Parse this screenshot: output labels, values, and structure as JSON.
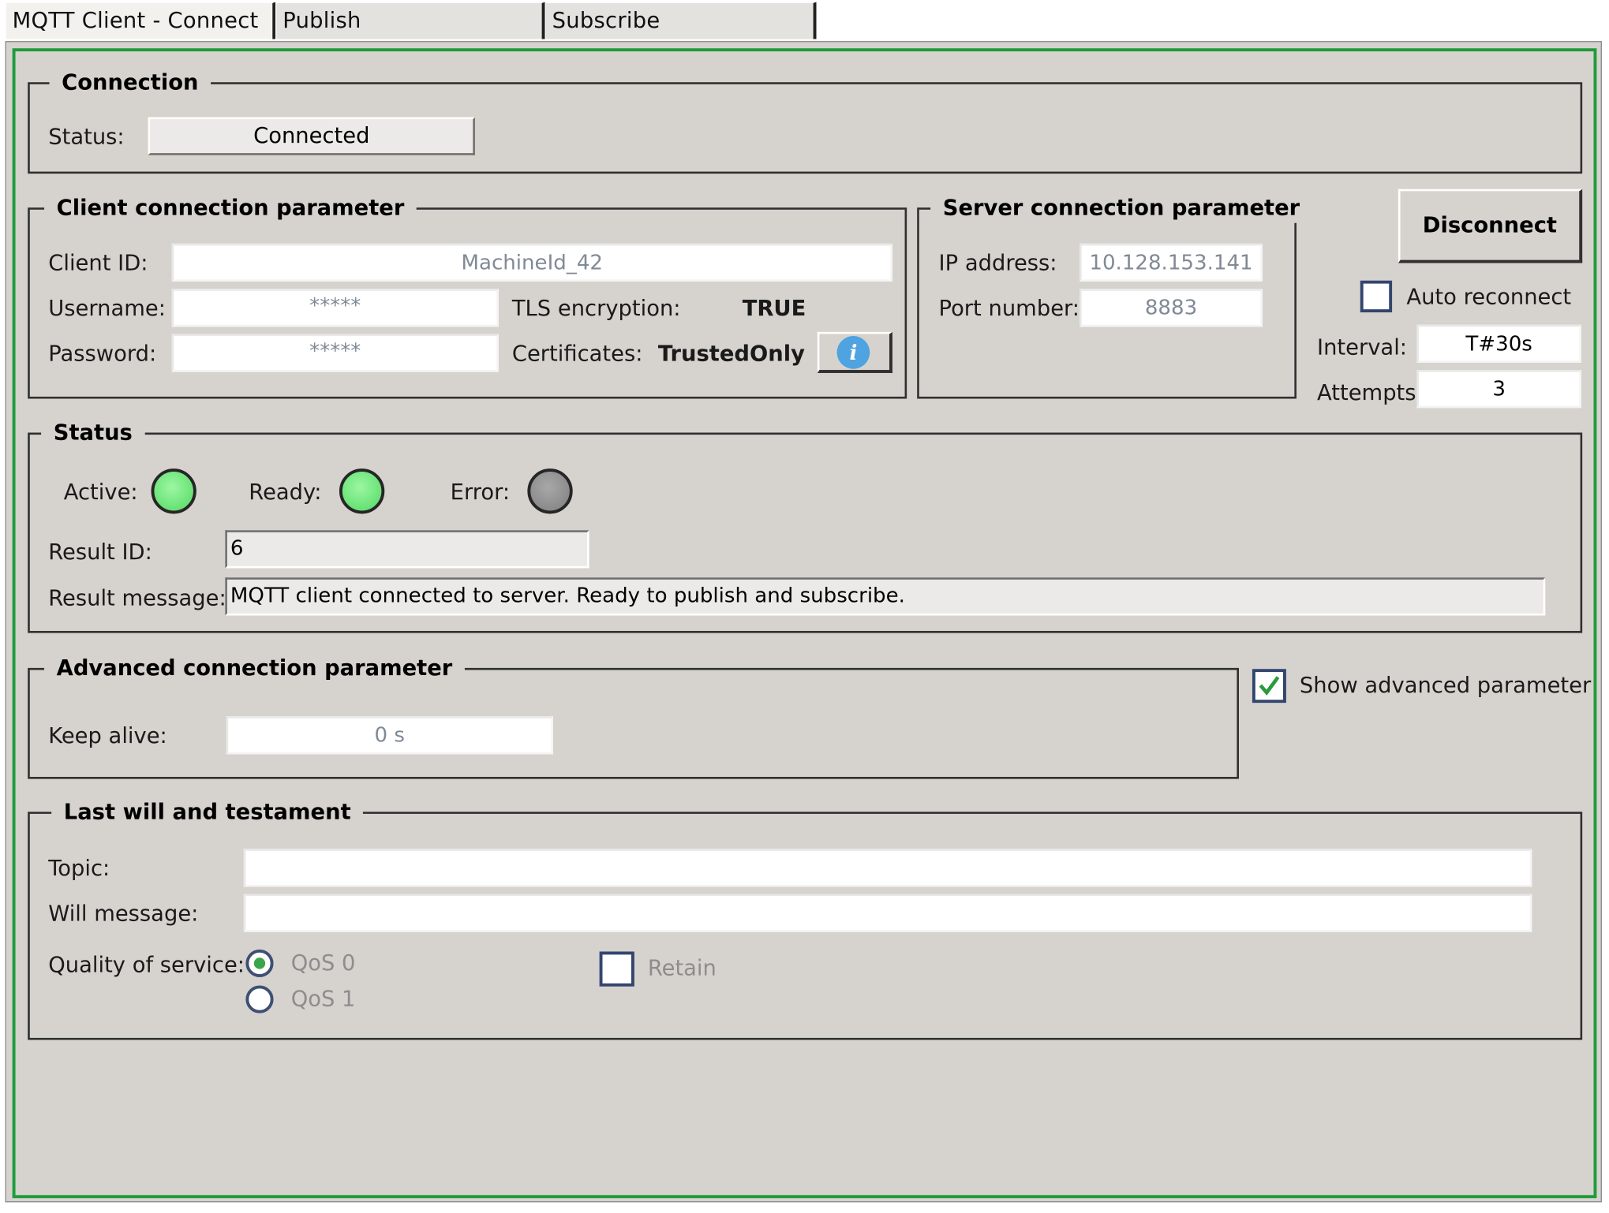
{
  "tabs": [
    {
      "label": "MQTT Client - Connect"
    },
    {
      "label": "Publish"
    },
    {
      "label": "Subscribe"
    }
  ],
  "connection": {
    "legend": "Connection",
    "status_label": "Status:",
    "status_value": "Connected"
  },
  "client": {
    "legend": "Client connection parameter",
    "client_id_label": "Client ID:",
    "client_id_value": "MachineId_42",
    "username_label": "Username:",
    "username_value": "*****",
    "password_label": "Password:",
    "password_value": "*****",
    "tls_label": "TLS encryption:",
    "tls_value": "TRUE",
    "cert_label": "Certificates:",
    "cert_value": "TrustedOnly",
    "info_icon_glyph": "i"
  },
  "server": {
    "legend": "Server connection parameter",
    "ip_label": "IP address:",
    "ip_value": "10.128.153.141",
    "port_label": "Port number:",
    "port_value": "8883"
  },
  "side": {
    "disconnect_label": "Disconnect",
    "auto_reconnect_label": "Auto reconnect",
    "auto_reconnect_checked": false,
    "interval_label": "Interval:",
    "interval_value": "T#30s",
    "attempts_label": "Attempts:",
    "attempts_value": "3"
  },
  "status": {
    "legend": "Status",
    "active_label": "Active:",
    "active_on": true,
    "ready_label": "Ready:",
    "ready_on": true,
    "error_label": "Error:",
    "error_on": false,
    "result_id_label": "Result ID:",
    "result_id_value": "6",
    "result_msg_label": "Result message:",
    "result_msg_value": "MQTT client connected to server. Ready to publish and subscribe."
  },
  "advanced": {
    "legend": "Advanced connection parameter",
    "keep_alive_label": "Keep alive:",
    "keep_alive_value": "0 s",
    "show_label": "Show advanced parameter",
    "show_checked": true
  },
  "lastwill": {
    "legend": "Last will and testament",
    "topic_label": "Topic:",
    "topic_value": "",
    "will_label": "Will message:",
    "will_value": "",
    "qos_label": "Quality of service:",
    "qos0_label": "QoS 0",
    "qos1_label": "QoS 1",
    "qos_selected": "QoS 0",
    "retain_label": "Retain",
    "retain_checked": false
  },
  "colors": {
    "panel_bg": "#d6d3ce",
    "frame_accent": "#1f9b3c",
    "led_on": "#6fe57b",
    "led_off": "#8f8f8f",
    "info_icon": "#4fa3e0"
  }
}
